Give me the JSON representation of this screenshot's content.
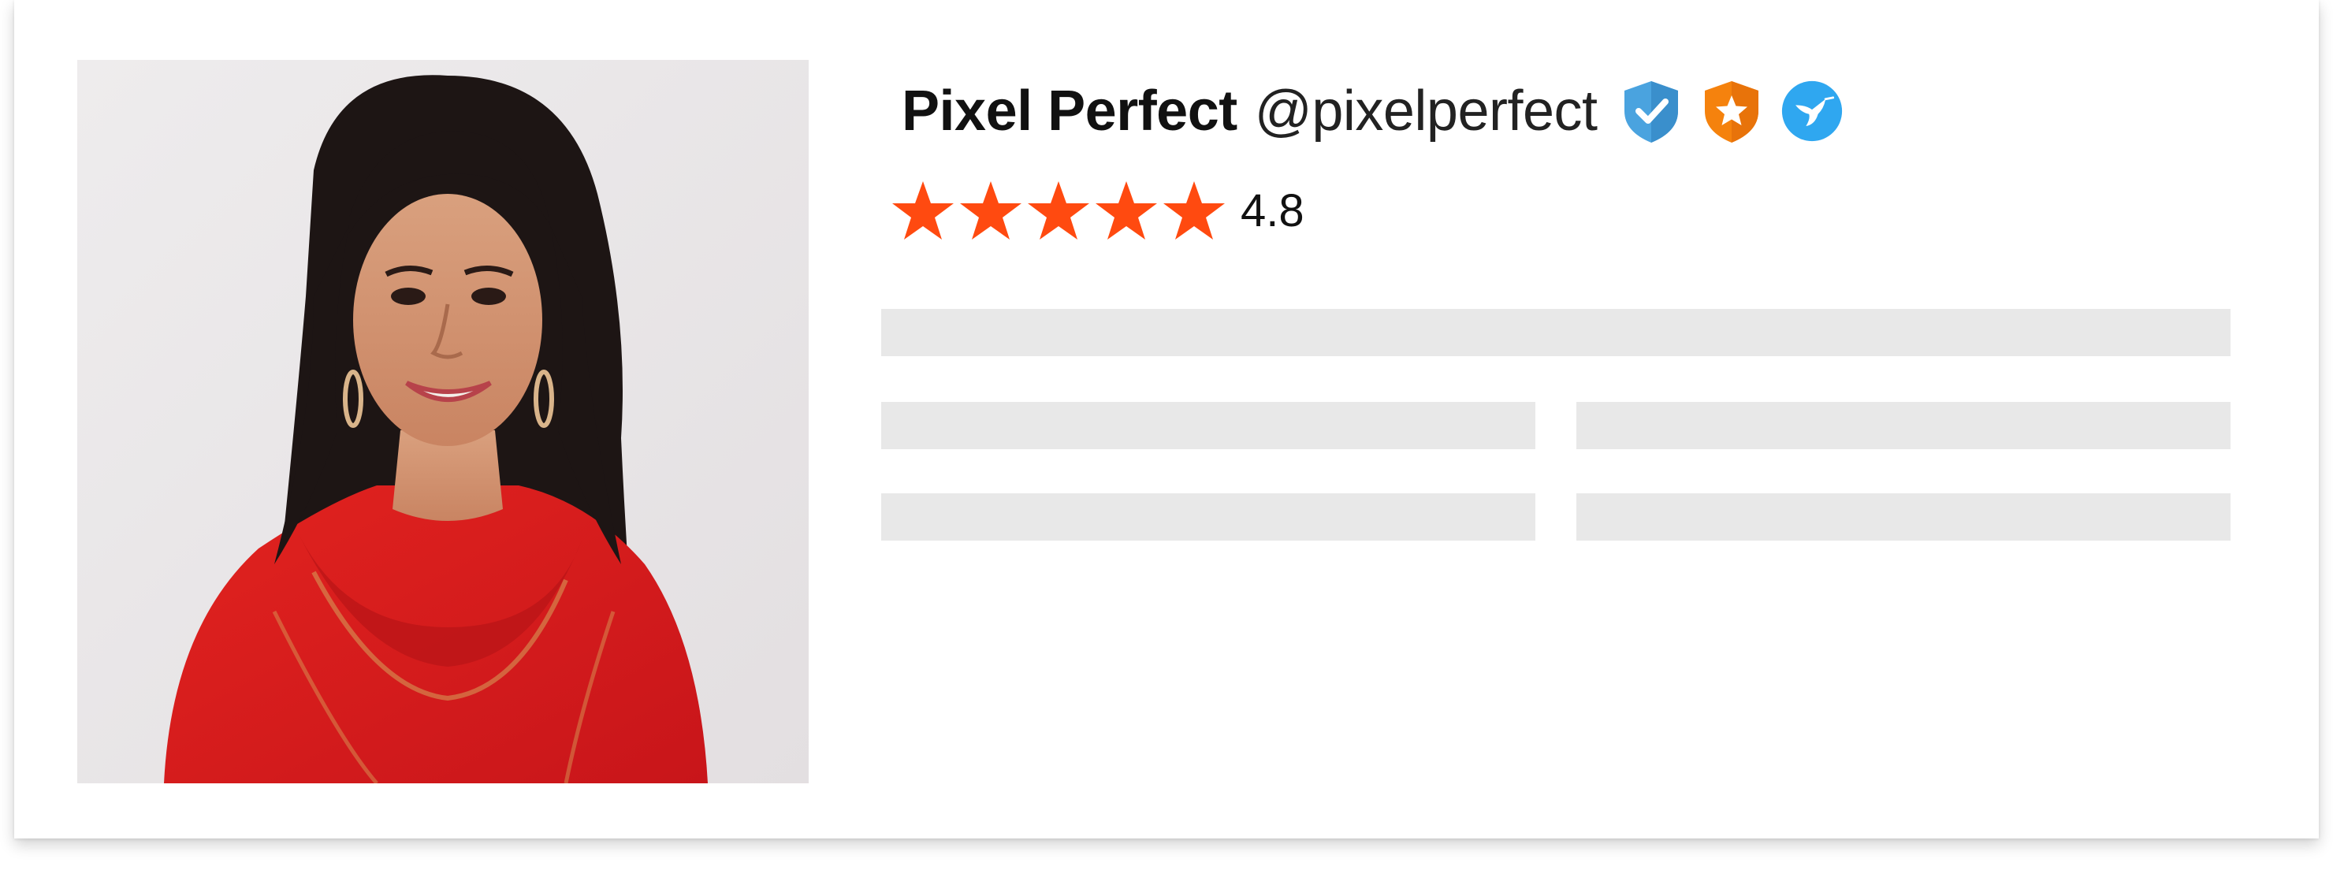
{
  "profile": {
    "name": "Pixel Perfect",
    "handle": "@pixelperfect",
    "photo": "profile-photo",
    "badges": [
      {
        "icon": "verified-shield-icon",
        "color": "#4aa3df"
      },
      {
        "icon": "star-shield-icon",
        "color": "#f5820d"
      },
      {
        "icon": "hummingbird-icon",
        "color": "#2fa7f0"
      }
    ]
  },
  "rating": {
    "stars": 5,
    "value": "4.8",
    "star_color": "#ff4a10",
    "star_icon": "star-icon"
  },
  "placeholders": {
    "color": "#e8e8e8",
    "rows": 3,
    "description": "loading skeleton bars"
  }
}
